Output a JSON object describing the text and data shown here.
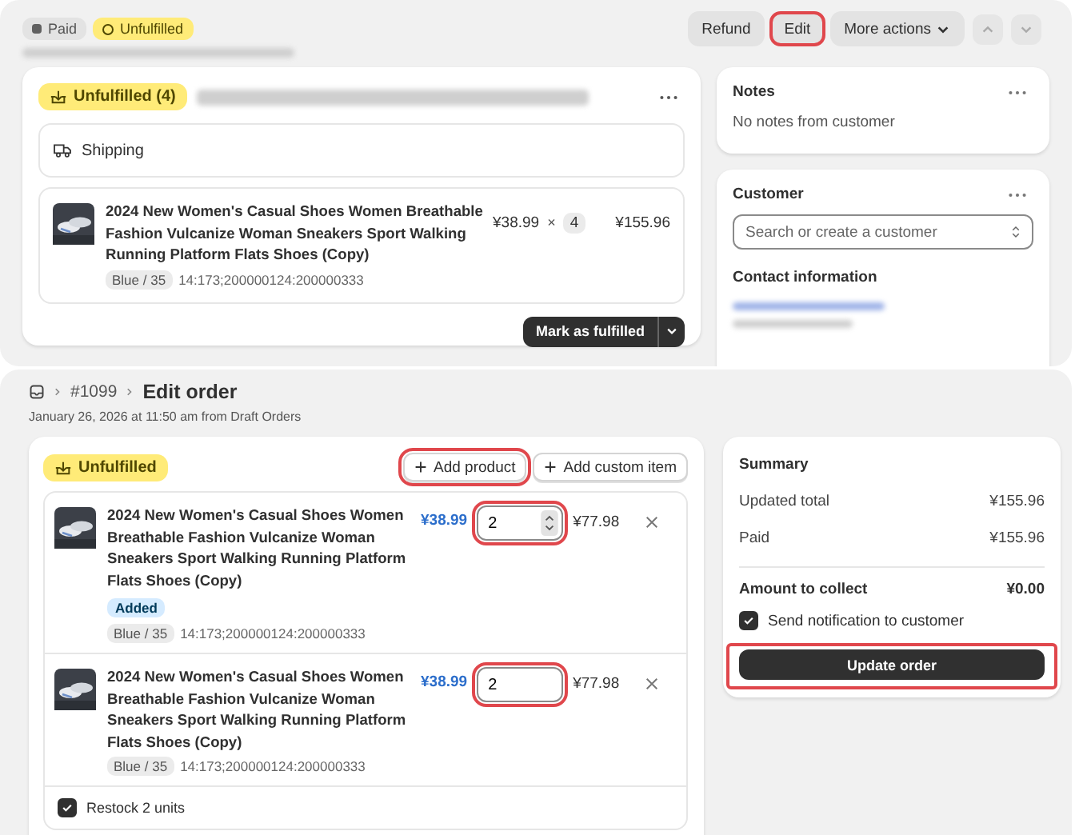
{
  "top": {
    "badges": [
      {
        "label": "Paid",
        "kind": "paid"
      },
      {
        "label": "Unfulfilled",
        "kind": "unfulfilled"
      }
    ],
    "actions": [
      {
        "label": "Refund",
        "kind": "button",
        "highlighted": false
      },
      {
        "label": "Edit",
        "kind": "button",
        "highlighted": true
      },
      {
        "label": "More actions",
        "kind": "menu",
        "highlighted": false
      }
    ],
    "fulfillment": {
      "status": "Unfulfilled (4)",
      "delivery": "Shipping",
      "item": {
        "title": "2024 New Women's Casual Shoes Women Breathable Fashion Vulcanize Woman Sneakers Sport Walking Running Platform Flats Shoes (Copy)",
        "variant": "Blue / 35",
        "sku": "14:173;200000124:200000333",
        "price": "¥38.99",
        "times": "×",
        "quantity": "4",
        "total": "¥155.96"
      },
      "primary": "Mark as fulfilled"
    },
    "notes": {
      "title": "Notes",
      "text": "No notes from customer"
    },
    "customer": {
      "title": "Customer",
      "search": {
        "placeholder": "Search or create a customer"
      },
      "contact_title": "Contact information"
    }
  },
  "edit_order": {
    "breadcrumb": "#1099",
    "title": "Edit order",
    "subtitle": "January 26, 2026 at 11:50 am from Draft Orders",
    "status": "Unfulfilled",
    "buttons": [
      {
        "label": "Add product",
        "highlighted": true
      },
      {
        "label": "Add custom item",
        "highlighted": false
      }
    ],
    "items": [
      {
        "title": "2024 New Women's Casual Shoes Women Breathable Fashion Vulcanize Woman Sneakers Sport Walking Running Platform Flats Shoes (Copy)",
        "badge": "Added",
        "variant": "Blue / 35",
        "sku": "14:173;200000124:200000333",
        "price": "¥38.99",
        "quantity": "2",
        "stepper": true,
        "highlighted": true,
        "total": "¥77.98"
      },
      {
        "title": "2024 New Women's Casual Shoes Women Breathable Fashion Vulcanize Woman Sneakers Sport Walking Running Platform Flats Shoes (Copy)",
        "variant": "Blue / 35",
        "sku": "14:173;200000124:200000333",
        "price": "¥38.99",
        "quantity": "2",
        "stepper": false,
        "highlighted": true,
        "total": "¥77.98"
      }
    ],
    "restock": {
      "label": "Restock 2 units",
      "checked": true
    }
  },
  "summary": {
    "title": "Summary",
    "rows": [
      {
        "label": "Updated total",
        "value": "¥155.96",
        "kind": "normal"
      },
      {
        "label": "Paid",
        "value": "¥155.96",
        "kind": "normal"
      },
      {
        "label": "Amount to collect",
        "value": "¥0.00",
        "kind": "total"
      }
    ],
    "notify": {
      "label": "Send notification to customer",
      "checked": true
    },
    "update": {
      "label": "Update order",
      "highlighted": true
    }
  }
}
